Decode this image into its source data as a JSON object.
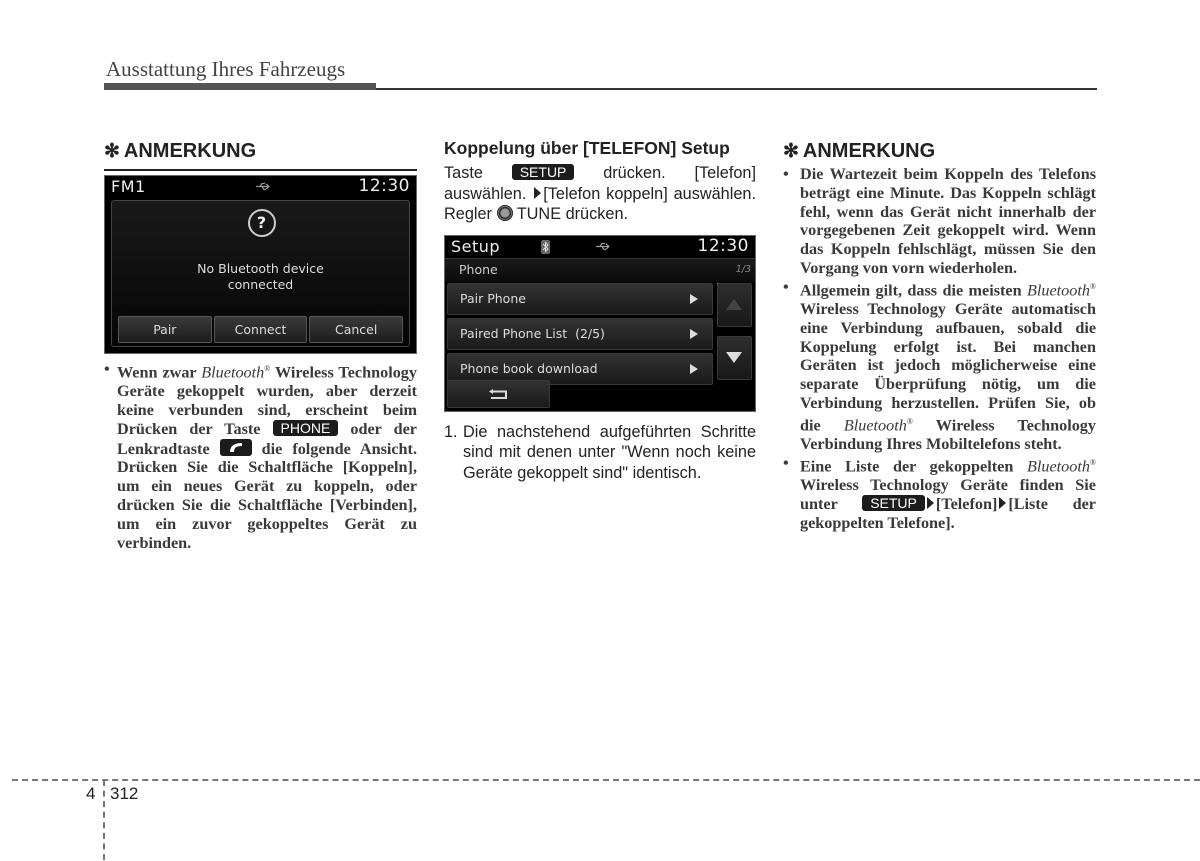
{
  "header": {
    "title": "Ausstattung Ihres Fahrzeugs"
  },
  "left_column": {
    "note_heading": "ANMERKUNG",
    "note_symbol": "✻",
    "screen": {
      "source": "FM1",
      "time": "12:30",
      "status_icon": "usb-icon",
      "dialog_icon": "question-icon",
      "question_mark": "?",
      "message_line1": "No Bluetooth device",
      "message_line2": "connected",
      "buttons": [
        "Pair",
        "Connect",
        "Cancel"
      ]
    },
    "bullet": {
      "symbol": "•",
      "part1": "Wenn zwar ",
      "bluetooth": "Bluetooth",
      "registered": "®",
      "part2": " Wireless Technology Geräte gekoppelt wurden, aber derzeit keine verbunden sind, erscheint beim Drücken der Taste ",
      "phone_key": "PHONE",
      "part3": " oder der Lenkradtaste ",
      "steering_key_icon": "phone-call-icon",
      "part4": " die folgende Ansicht. Drücken Sie die Schaltfläche [Koppeln], um ein neues Gerät zu koppeln, oder drücken Sie die Schaltfläche [Verbinden], um ein zuvor gekoppeltes Gerät zu verbinden."
    }
  },
  "middle_column": {
    "heading": "Koppelung über [TELEFON] Setup",
    "intro": {
      "part1": "Taste ",
      "setup_key": "SETUP",
      "part2": " drücken. [Telefon] auswählen. ",
      "part3": "[Telefon koppeln] auswählen. Regler ",
      "knob_icon": "tune-knob-icon",
      "part4": " TUNE drücken."
    },
    "screen": {
      "title": "Setup",
      "time": "12:30",
      "status_icons": [
        "bluetooth-icon",
        "usb-icon"
      ],
      "subheader": "Phone",
      "page_indicator": "1/3",
      "menu_items": [
        {
          "label": "Pair Phone"
        },
        {
          "label": "Paired Phone List  (2/5)"
        },
        {
          "label": "Phone book download"
        }
      ],
      "scroll_up_icon": "arrow-up-icon",
      "scroll_down_icon": "arrow-down-icon",
      "back_icon": "back-icon"
    },
    "steps": [
      {
        "number": "1.",
        "text": "Die nachstehend aufgeführten Schritte sind mit denen unter \"Wenn noch keine Geräte gekoppelt sind\" identisch."
      }
    ]
  },
  "right_column": {
    "note_heading": "ANMERKUNG",
    "note_symbol": "✻",
    "bullets": [
      {
        "symbol": "•",
        "text": "Die Wartezeit beim Koppeln des Telefons beträgt eine Minute. Das Koppeln schlägt fehl, wenn das Gerät nicht innerhalb der vorgegebenen Zeit gekoppelt wird. Wenn das Koppeln fehlschlägt, müssen Sie den Vorgang von vorn wiederholen."
      },
      {
        "symbol": "•",
        "part1": "Allgemein gilt, dass die meisten ",
        "bluetooth": "Bluetooth",
        "registered": "®",
        "part2": " Wireless Technology Geräte automatisch eine Verbindung aufbauen, sobald die Koppelung erfolgt ist. Bei manchen Geräten ist jedoch möglicherweise eine separate Überprüfung nötig, um die Verbindung herzustellen. Prüfen Sie, ob die ",
        "bluetooth2": "Bluetooth",
        "part3": " Wireless Technology Verbindung Ihres Mobiltelefons steht."
      },
      {
        "symbol": "•",
        "part1": "Eine Liste der gekoppelten ",
        "bluetooth": "Bluetooth",
        "registered": "®",
        "part2": " Wireless Technology Geräte finden Sie unter ",
        "setup_key": "SETUP",
        "part3": "[Telefon]",
        "part4": "[Liste der gekoppelten Telefone]."
      }
    ]
  },
  "footer": {
    "chapter": "4",
    "page": "312"
  }
}
